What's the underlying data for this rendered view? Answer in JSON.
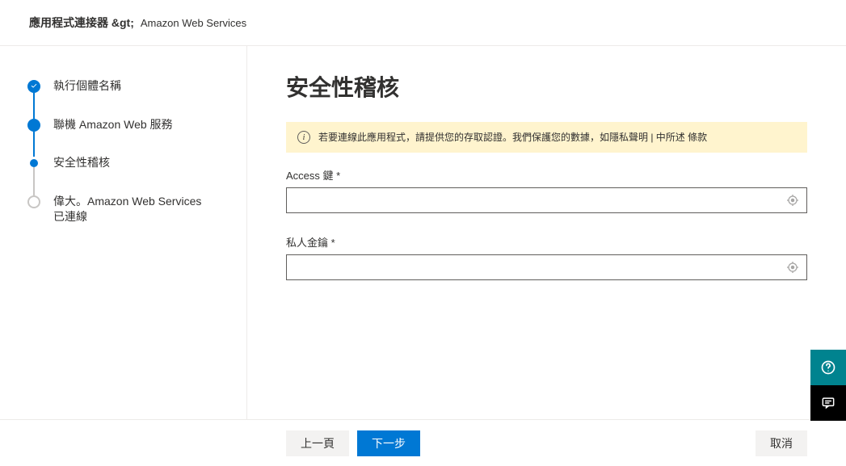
{
  "breadcrumb": {
    "part1": "應用程式連接器 &gt;",
    "part2": "Amazon Web Services"
  },
  "steps": [
    {
      "label": "執行個體名稱",
      "state": "done"
    },
    {
      "label": "聯機 Amazon Web 服務",
      "state": "active"
    },
    {
      "label": "安全性稽核",
      "state": "current"
    },
    {
      "label": "偉大。Amazon Web Services 已連線",
      "state": "future"
    }
  ],
  "main": {
    "title": "安全性稽核",
    "banner": "若要連線此應用程式，請提供您的存取認證。我們保護您的數據，如隱私聲明 | 中所述 條款"
  },
  "fields": {
    "access_key": {
      "label": "Access 鍵 *",
      "value": ""
    },
    "private_key": {
      "label": "私人金鑰 *",
      "value": ""
    }
  },
  "footer": {
    "prev": "上一頁",
    "next": "下一步",
    "cancel": "取消"
  },
  "icons": {
    "info": "info-icon",
    "reveal": "reveal-icon",
    "help": "help-icon",
    "chat": "chat-icon",
    "check": "check-icon"
  }
}
